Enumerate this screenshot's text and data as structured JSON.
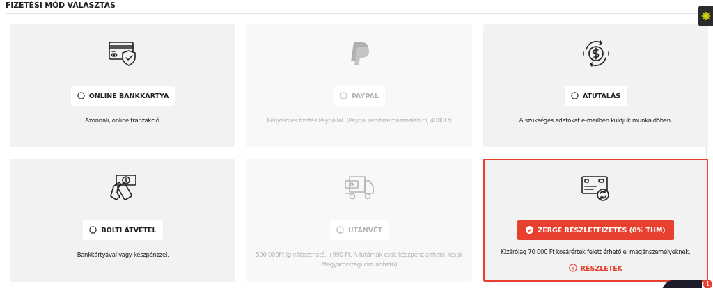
{
  "heading": "FIZETÉSI MÓD VÁLASZTÁS",
  "options": [
    {
      "kind": "card-shield",
      "label": "ONLINE BANKKÁRTYA",
      "description": "Azonnali, online tranzakció.",
      "selected": false,
      "disabled": false
    },
    {
      "kind": "paypal",
      "label": "PAYPAL",
      "description": "Kényelmes fizetés Paypallal. (Paypal rendszerhasználati díj 4000Ft)",
      "selected": false,
      "disabled": true
    },
    {
      "kind": "transfer",
      "label": "ÁTUTALÁS",
      "description": "A szükséges adatokat e-mailben küldjük munkaidőben.",
      "selected": false,
      "disabled": false
    },
    {
      "kind": "cash-hand",
      "label": "BOLTI ÁTVÉTEL",
      "description": "Bankkártyával vagy készpénzzel.",
      "selected": false,
      "disabled": false
    },
    {
      "kind": "truck",
      "label": "UTÁNVÉT",
      "description": "500 000Ft-ig választható. +990 Ft. A futárnak csak készpénz adható. (csak Magyarországi cím adható)",
      "selected": false,
      "disabled": true
    },
    {
      "kind": "card-refresh",
      "label": "ZERGE RÉSZLETFIZETÉS (0% THM)",
      "description": "Kizárólag 70 000 Ft kosárérték felett érhető el magánszemélyeknek.",
      "selected": true,
      "disabled": false,
      "link": "RÉSZLETEK"
    }
  ],
  "chat_badge": "1"
}
